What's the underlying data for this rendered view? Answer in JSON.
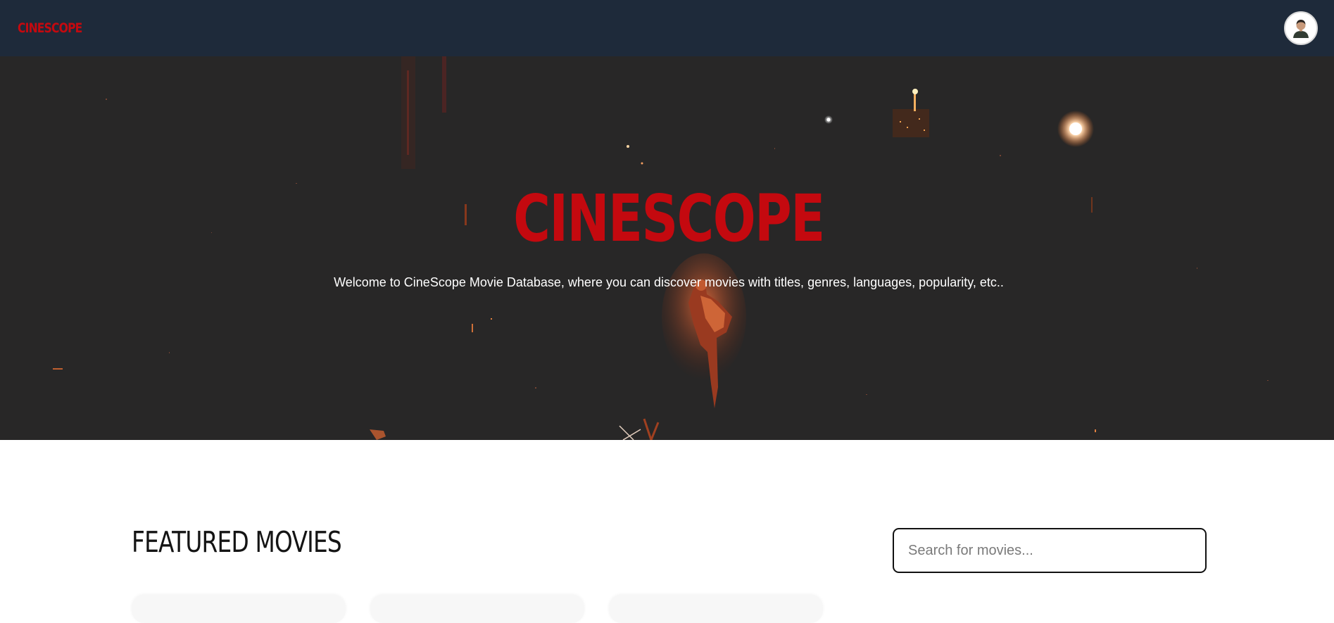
{
  "header": {
    "brand": "CINESCOPE",
    "avatar_icon": "user-avatar-icon"
  },
  "hero": {
    "title": "CINESCOPE",
    "subtitle": "Welcome to CineScope Movie Database, where you can discover movies with titles, genres, languages, popularity, etc.."
  },
  "featured": {
    "title": "FEATURED MOVIES"
  },
  "search": {
    "placeholder": "Search for movies...",
    "value": ""
  },
  "colors": {
    "brand_red": "#c4090f",
    "navbar": "#1e2a3a",
    "hero_bg": "#282727"
  }
}
